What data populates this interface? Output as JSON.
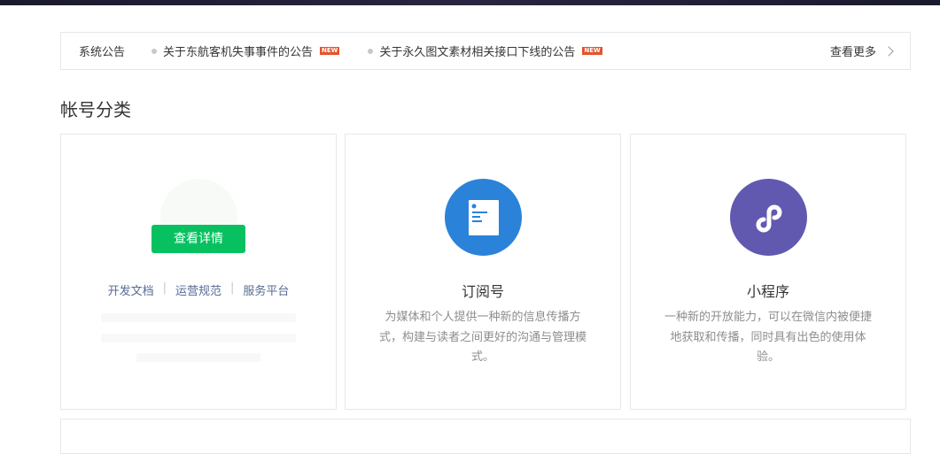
{
  "notice": {
    "label": "系统公告",
    "items": [
      {
        "text": "关于东航客机失事事件的公告",
        "badge": "NEW"
      },
      {
        "text": "关于永久图文素材相关接口下线的公告",
        "badge": "NEW"
      }
    ],
    "more": "查看更多"
  },
  "section_title": "帐号分类",
  "cards": [
    {
      "button": "查看详情",
      "links": [
        "开发文档",
        "运营规范",
        "服务平台"
      ],
      "separator": "|"
    },
    {
      "title": "订阅号",
      "desc": "为媒体和个人提供一种新的信息传播方式，构建与读者之间更好的沟通与管理模式。",
      "color": "#2b82d9"
    },
    {
      "title": "小程序",
      "desc": "一种新的开放能力，可以在微信内被便捷地获取和传播，同时具有出色的使用体验。",
      "color": "#6159b0"
    }
  ]
}
